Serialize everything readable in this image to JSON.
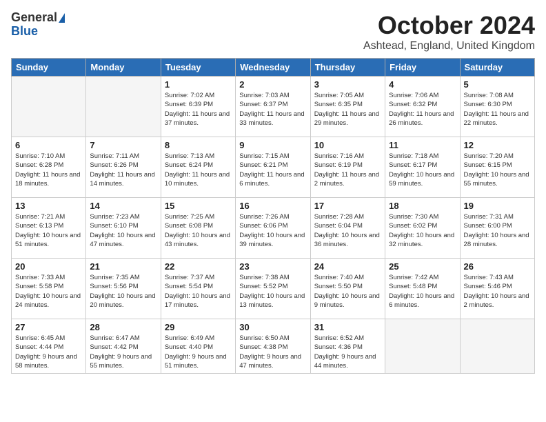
{
  "logo": {
    "line1": "General",
    "line2": "Blue"
  },
  "title": "October 2024",
  "location": "Ashtead, England, United Kingdom",
  "days_of_week": [
    "Sunday",
    "Monday",
    "Tuesday",
    "Wednesday",
    "Thursday",
    "Friday",
    "Saturday"
  ],
  "weeks": [
    [
      {
        "day": "",
        "info": ""
      },
      {
        "day": "",
        "info": ""
      },
      {
        "day": "1",
        "info": "Sunrise: 7:02 AM\nSunset: 6:39 PM\nDaylight: 11 hours and 37 minutes."
      },
      {
        "day": "2",
        "info": "Sunrise: 7:03 AM\nSunset: 6:37 PM\nDaylight: 11 hours and 33 minutes."
      },
      {
        "day": "3",
        "info": "Sunrise: 7:05 AM\nSunset: 6:35 PM\nDaylight: 11 hours and 29 minutes."
      },
      {
        "day": "4",
        "info": "Sunrise: 7:06 AM\nSunset: 6:32 PM\nDaylight: 11 hours and 26 minutes."
      },
      {
        "day": "5",
        "info": "Sunrise: 7:08 AM\nSunset: 6:30 PM\nDaylight: 11 hours and 22 minutes."
      }
    ],
    [
      {
        "day": "6",
        "info": "Sunrise: 7:10 AM\nSunset: 6:28 PM\nDaylight: 11 hours and 18 minutes."
      },
      {
        "day": "7",
        "info": "Sunrise: 7:11 AM\nSunset: 6:26 PM\nDaylight: 11 hours and 14 minutes."
      },
      {
        "day": "8",
        "info": "Sunrise: 7:13 AM\nSunset: 6:24 PM\nDaylight: 11 hours and 10 minutes."
      },
      {
        "day": "9",
        "info": "Sunrise: 7:15 AM\nSunset: 6:21 PM\nDaylight: 11 hours and 6 minutes."
      },
      {
        "day": "10",
        "info": "Sunrise: 7:16 AM\nSunset: 6:19 PM\nDaylight: 11 hours and 2 minutes."
      },
      {
        "day": "11",
        "info": "Sunrise: 7:18 AM\nSunset: 6:17 PM\nDaylight: 10 hours and 59 minutes."
      },
      {
        "day": "12",
        "info": "Sunrise: 7:20 AM\nSunset: 6:15 PM\nDaylight: 10 hours and 55 minutes."
      }
    ],
    [
      {
        "day": "13",
        "info": "Sunrise: 7:21 AM\nSunset: 6:13 PM\nDaylight: 10 hours and 51 minutes."
      },
      {
        "day": "14",
        "info": "Sunrise: 7:23 AM\nSunset: 6:10 PM\nDaylight: 10 hours and 47 minutes."
      },
      {
        "day": "15",
        "info": "Sunrise: 7:25 AM\nSunset: 6:08 PM\nDaylight: 10 hours and 43 minutes."
      },
      {
        "day": "16",
        "info": "Sunrise: 7:26 AM\nSunset: 6:06 PM\nDaylight: 10 hours and 39 minutes."
      },
      {
        "day": "17",
        "info": "Sunrise: 7:28 AM\nSunset: 6:04 PM\nDaylight: 10 hours and 36 minutes."
      },
      {
        "day": "18",
        "info": "Sunrise: 7:30 AM\nSunset: 6:02 PM\nDaylight: 10 hours and 32 minutes."
      },
      {
        "day": "19",
        "info": "Sunrise: 7:31 AM\nSunset: 6:00 PM\nDaylight: 10 hours and 28 minutes."
      }
    ],
    [
      {
        "day": "20",
        "info": "Sunrise: 7:33 AM\nSunset: 5:58 PM\nDaylight: 10 hours and 24 minutes."
      },
      {
        "day": "21",
        "info": "Sunrise: 7:35 AM\nSunset: 5:56 PM\nDaylight: 10 hours and 20 minutes."
      },
      {
        "day": "22",
        "info": "Sunrise: 7:37 AM\nSunset: 5:54 PM\nDaylight: 10 hours and 17 minutes."
      },
      {
        "day": "23",
        "info": "Sunrise: 7:38 AM\nSunset: 5:52 PM\nDaylight: 10 hours and 13 minutes."
      },
      {
        "day": "24",
        "info": "Sunrise: 7:40 AM\nSunset: 5:50 PM\nDaylight: 10 hours and 9 minutes."
      },
      {
        "day": "25",
        "info": "Sunrise: 7:42 AM\nSunset: 5:48 PM\nDaylight: 10 hours and 6 minutes."
      },
      {
        "day": "26",
        "info": "Sunrise: 7:43 AM\nSunset: 5:46 PM\nDaylight: 10 hours and 2 minutes."
      }
    ],
    [
      {
        "day": "27",
        "info": "Sunrise: 6:45 AM\nSunset: 4:44 PM\nDaylight: 9 hours and 58 minutes."
      },
      {
        "day": "28",
        "info": "Sunrise: 6:47 AM\nSunset: 4:42 PM\nDaylight: 9 hours and 55 minutes."
      },
      {
        "day": "29",
        "info": "Sunrise: 6:49 AM\nSunset: 4:40 PM\nDaylight: 9 hours and 51 minutes."
      },
      {
        "day": "30",
        "info": "Sunrise: 6:50 AM\nSunset: 4:38 PM\nDaylight: 9 hours and 47 minutes."
      },
      {
        "day": "31",
        "info": "Sunrise: 6:52 AM\nSunset: 4:36 PM\nDaylight: 9 hours and 44 minutes."
      },
      {
        "day": "",
        "info": ""
      },
      {
        "day": "",
        "info": ""
      }
    ]
  ]
}
